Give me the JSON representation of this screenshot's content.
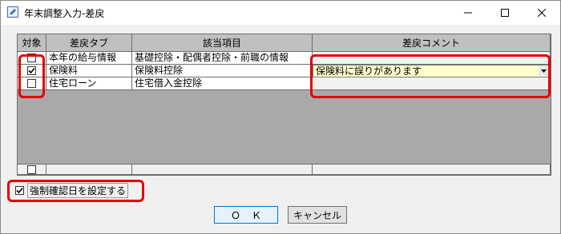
{
  "window": {
    "title": "年末調整入力-差戻",
    "icon": "edit-form-icon"
  },
  "grid": {
    "headers": {
      "target": "対象",
      "return_type": "差戻タブ",
      "item": "該当項目",
      "comment": "差戻コメント"
    },
    "rows": [
      {
        "checked": false,
        "return_type": "本年の給与情報",
        "item": "基礎控除・配偶者控除・前職の情報",
        "comment": ""
      },
      {
        "checked": true,
        "return_type": "保険料",
        "item": "保険料控除",
        "comment": "保険料に誤りがあります"
      },
      {
        "checked": false,
        "return_type": "住宅ローン",
        "item": "住宅借入金控除",
        "comment": ""
      }
    ],
    "footer_checked": false
  },
  "force_confirm": {
    "checked": true,
    "label": "強制確認日を設定する"
  },
  "buttons": {
    "ok": "ＯＫ",
    "cancel": "キャンセル"
  },
  "colors": {
    "highlight": "#e60000",
    "comment_input_bg": "#ffffcc",
    "ok_border": "#0078d7"
  }
}
